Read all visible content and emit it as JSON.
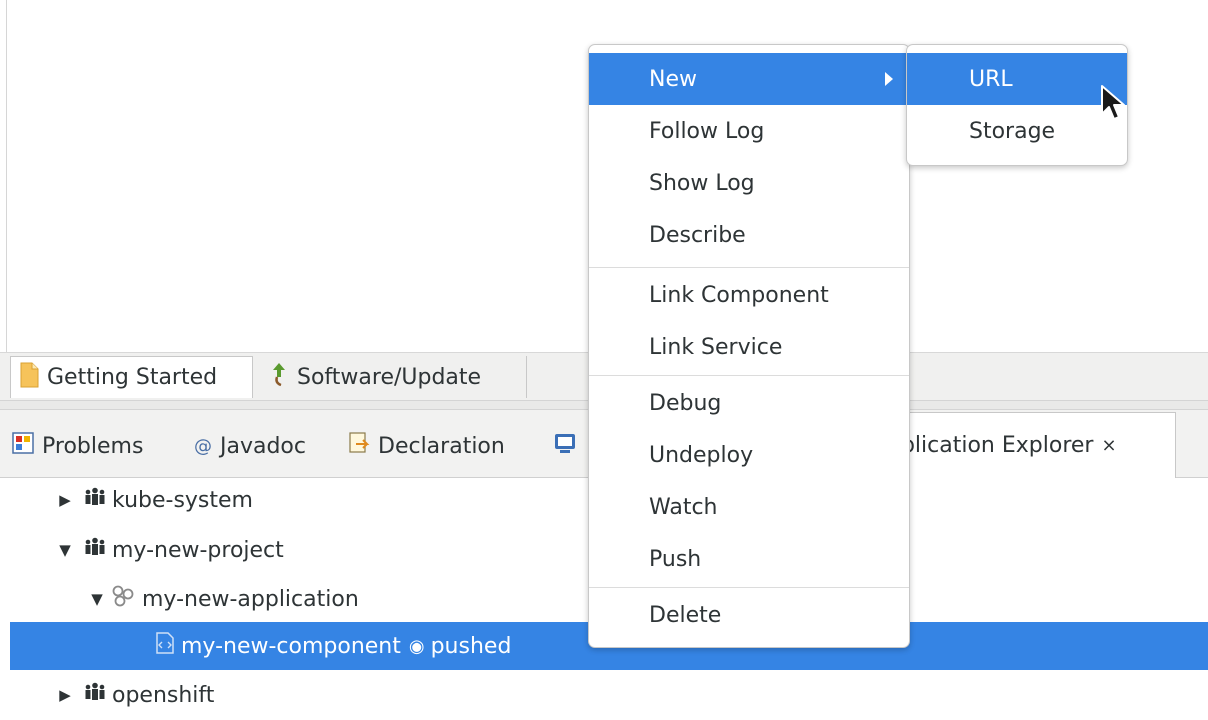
{
  "editor_tabs": [
    {
      "label": "Getting Started",
      "icon": "page-icon"
    },
    {
      "label": "Software/Update",
      "icon": "update-icon"
    }
  ],
  "view_tabs": [
    {
      "label": "Problems",
      "icon": "problems-icon"
    },
    {
      "label": "Javadoc",
      "icon": "at-icon"
    },
    {
      "label": "Declaration",
      "icon": "declaration-icon"
    },
    {
      "label": "",
      "icon": "console-icon"
    },
    {
      "label": "pplication Explorer",
      "icon": "close-icon"
    }
  ],
  "tree": {
    "kube": "kube-system",
    "my_project": "my-new-project",
    "my_application": "my-new-application",
    "my_component": "my-new-component",
    "component_state": "pushed",
    "openshift": "openshift"
  },
  "context_menu": {
    "new": "New",
    "follow_log": "Follow Log",
    "show_log": "Show Log",
    "describe": "Describe",
    "link_component": "Link Component",
    "link_service": "Link Service",
    "debug": "Debug",
    "undeploy": "Undeploy",
    "watch": "Watch",
    "push": "Push",
    "delete": "Delete"
  },
  "submenu": {
    "url": "URL",
    "storage": "Storage"
  },
  "colors": {
    "selection": "#3584e4",
    "text": "#2e3436"
  }
}
